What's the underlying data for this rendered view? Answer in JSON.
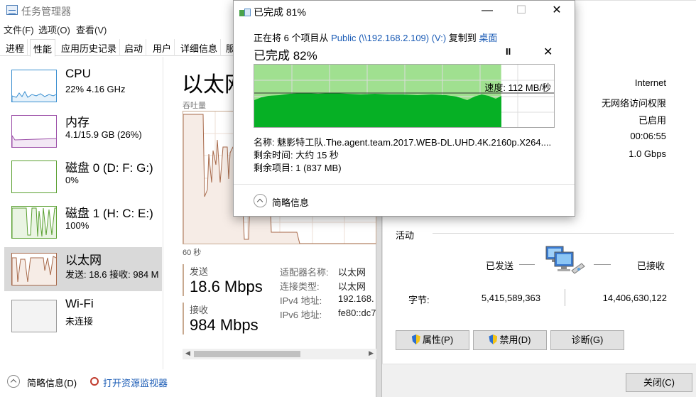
{
  "task_manager": {
    "title": "任务管理器",
    "menu": [
      "文件(F)",
      "选项(O)",
      "查看(V)"
    ],
    "tabs": [
      "进程",
      "性能",
      "应用历史记录",
      "启动",
      "用户",
      "详细信息",
      "服"
    ],
    "active_tab": "性能",
    "sidebar": [
      {
        "name": "CPU",
        "sub": "22% 4.16 GHz"
      },
      {
        "name": "内存",
        "sub": "4.1/15.9 GB (26%)"
      },
      {
        "name": "磁盘 0 (D: F: G:)",
        "sub": "0%"
      },
      {
        "name": "磁盘 1 (H: C: E:)",
        "sub": "100%"
      },
      {
        "name": "以太网",
        "sub": "发送: 18.6 接收: 984 M"
      },
      {
        "name": "Wi-Fi",
        "sub": "未连接"
      }
    ],
    "main": {
      "title": "以太网",
      "throughput_label": "吞吐量",
      "time_label": "60 秒",
      "send_label": "发送",
      "send_value": "18.6 Mbps",
      "recv_label": "接收",
      "recv_value": "984 Mbps",
      "details": [
        {
          "key": "适配器名称:",
          "value": "以太网"
        },
        {
          "key": "连接类型:",
          "value": "以太网"
        },
        {
          "key": "IPv4 地址:",
          "value": "192.168."
        },
        {
          "key": "IPv6 地址:",
          "value": "fe80::dc7"
        }
      ]
    },
    "footer": {
      "brief": "简略信息(D)",
      "monitor": "打开资源监视器"
    }
  },
  "copy_dialog": {
    "title": "已完成 81%",
    "line_prefix": "正在将 6 个项目从 ",
    "source": "Public (\\\\192.168.2.109) (V:)",
    "line_mid": " 复制到 ",
    "destination": "桌面",
    "progress_text": "已完成 82%",
    "progress": 0.82,
    "speed": "速度: 112 MB/秒",
    "name_line": "名称: 魅影特工队.The.agent.team.2017.WEB-DL.UHD.4K.2160p.X264....",
    "time_line": "剩余时间: 大约 15 秒",
    "items_line": "剩余项目: 1 (837 MB)",
    "brief": "简略信息",
    "controls": {
      "minimize": "—",
      "maximize": "☐",
      "close": "✕",
      "pause": "II",
      "cancel": "✕"
    }
  },
  "network_status": {
    "connection": [
      {
        "value": "Internet"
      },
      {
        "value": "无网络访问权限"
      },
      {
        "value": "已启用"
      },
      {
        "value": "00:06:55"
      },
      {
        "value": "1.0 Gbps"
      }
    ],
    "activity_title": "活动",
    "sent_label": "已发送",
    "recv_label": "已接收",
    "bytes_label": "字节:",
    "bytes_sent": "5,415,589,363",
    "bytes_recv": "14,406,630,122",
    "buttons": {
      "properties": "属性(P)",
      "disable": "禁用(D)",
      "diagnose": "诊断(G)",
      "close": "关闭(C)"
    }
  },
  "colors": {
    "copy_fill": "#06b025",
    "copy_fill_light": "#a0e090",
    "ethernet_line": "#a7694a",
    "ethernet_fill": "#f6ece6",
    "link": "#1a5bb5"
  }
}
